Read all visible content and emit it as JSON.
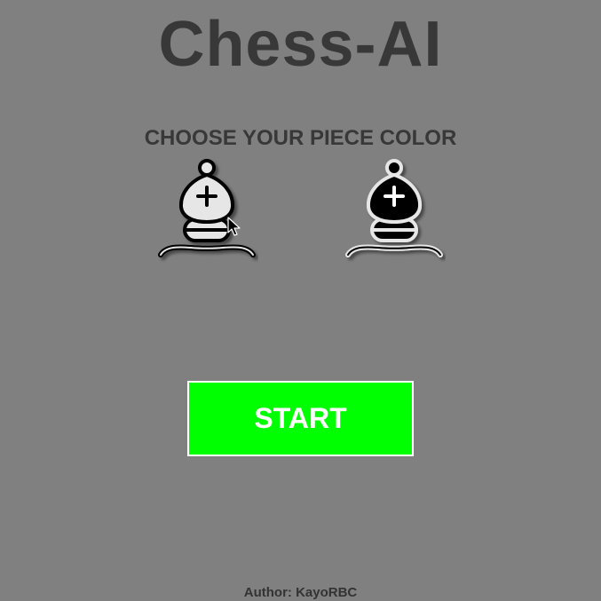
{
  "app": {
    "title": "Chess-AI",
    "subtitle": "CHOOSE YOUR PIECE COLOR",
    "start_label": "START",
    "author": "Author: KayoRBC"
  },
  "pieces": [
    {
      "name": "white-bishop",
      "fill": "#e6e6e6",
      "stroke": "#000000",
      "cross": "#000000"
    },
    {
      "name": "black-bishop",
      "fill": "#000000",
      "stroke": "#e6e6e6",
      "cross": "#ffffff"
    }
  ],
  "colors": {
    "background": "#808080",
    "text": "#383838",
    "start_button": "#00ff00",
    "start_border": "#ffffff"
  }
}
